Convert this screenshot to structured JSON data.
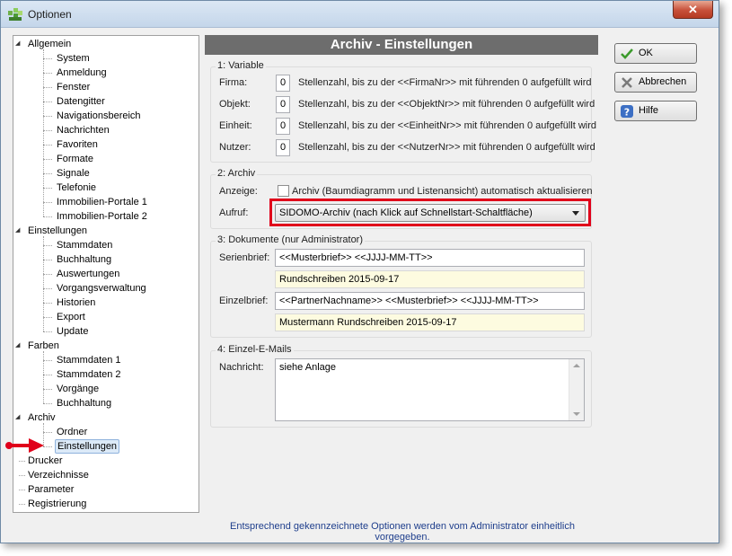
{
  "window": {
    "title": "Optionen",
    "close_label": "✕"
  },
  "tree": {
    "items": [
      {
        "label": "Allgemein",
        "level": 0,
        "expanded": true
      },
      {
        "label": "System",
        "level": 1
      },
      {
        "label": "Anmeldung",
        "level": 1
      },
      {
        "label": "Fenster",
        "level": 1
      },
      {
        "label": "Datengitter",
        "level": 1
      },
      {
        "label": "Navigationsbereich",
        "level": 1
      },
      {
        "label": "Nachrichten",
        "level": 1
      },
      {
        "label": "Favoriten",
        "level": 1
      },
      {
        "label": "Formate",
        "level": 1
      },
      {
        "label": "Signale",
        "level": 1
      },
      {
        "label": "Telefonie",
        "level": 1
      },
      {
        "label": "Immobilien-Portale 1",
        "level": 1
      },
      {
        "label": "Immobilien-Portale 2",
        "level": 1
      },
      {
        "label": "Einstellungen",
        "level": 0,
        "expanded": true
      },
      {
        "label": "Stammdaten",
        "level": 1
      },
      {
        "label": "Buchhaltung",
        "level": 1
      },
      {
        "label": "Auswertungen",
        "level": 1
      },
      {
        "label": "Vorgangsverwaltung",
        "level": 1
      },
      {
        "label": "Historien",
        "level": 1
      },
      {
        "label": "Export",
        "level": 1
      },
      {
        "label": "Update",
        "level": 1
      },
      {
        "label": "Farben",
        "level": 0,
        "expanded": true
      },
      {
        "label": "Stammdaten 1",
        "level": 1
      },
      {
        "label": "Stammdaten 2",
        "level": 1
      },
      {
        "label": "Vorgänge",
        "level": 1
      },
      {
        "label": "Buchhaltung",
        "level": 1
      },
      {
        "label": "Archiv",
        "level": 0,
        "expanded": true
      },
      {
        "label": "Ordner",
        "level": 1
      },
      {
        "label": "Einstellungen",
        "level": 1,
        "selected": true
      },
      {
        "label": "Drucker",
        "level": 0
      },
      {
        "label": "Verzeichnisse",
        "level": 0
      },
      {
        "label": "Parameter",
        "level": 0
      },
      {
        "label": "Registrierung",
        "level": 0
      }
    ]
  },
  "panel": {
    "title": "Archiv - Einstellungen",
    "variable": {
      "group_title": "1: Variable",
      "rows": [
        {
          "label": "Firma:",
          "value": "0",
          "desc": "Stellenzahl, bis zu der <<FirmaNr>> mit führenden 0 aufgefüllt wird"
        },
        {
          "label": "Objekt:",
          "value": "0",
          "desc": "Stellenzahl, bis zu der <<ObjektNr>> mit führenden 0 aufgefüllt wird"
        },
        {
          "label": "Einheit:",
          "value": "0",
          "desc": "Stellenzahl, bis zu der <<EinheitNr>> mit führenden 0 aufgefüllt wird"
        },
        {
          "label": "Nutzer:",
          "value": "0",
          "desc": "Stellenzahl, bis zu der <<NutzerNr>> mit führenden 0 aufgefüllt wird"
        }
      ]
    },
    "archiv": {
      "group_title": "2: Archiv",
      "anzeige_label": "Anzeige:",
      "checkbox_label": "Archiv (Baumdiagramm und Listenansicht) automatisch aktualisieren",
      "aufruf_label": "Aufruf:",
      "aufruf_value": "SIDOMO-Archiv (nach Klick auf Schnellstart-Schaltfläche)",
      "highlight_color": "#e0001a"
    },
    "dokumente": {
      "group_title": "3: Dokumente  (nur Administrator)",
      "serienbrief_label": "Serienbrief:",
      "serienbrief_value": "<<Musterbrief>> <<JJJJ-MM-TT>>",
      "serienbrief_preview": "Rundschreiben 2015-09-17",
      "einzelbrief_label": "Einzelbrief:",
      "einzelbrief_value": "<<PartnerNachname>> <<Musterbrief>> <<JJJJ-MM-TT>>",
      "einzelbrief_preview": "Mustermann Rundschreiben 2015-09-17"
    },
    "emails": {
      "group_title": "4: Einzel-E-Mails",
      "nachricht_label": "Nachricht:",
      "nachricht_value": "siehe Anlage"
    }
  },
  "buttons": {
    "ok": "OK",
    "abbrechen": "Abbrechen",
    "hilfe": "Hilfe"
  },
  "footer": "Entsprechend gekennzeichnete Optionen werden vom Administrator einheitlich vorgegeben.",
  "colors": {
    "header_bg": "#6d6d6d",
    "footer_text": "#1e3e8c",
    "pointer": "#e0001a"
  }
}
